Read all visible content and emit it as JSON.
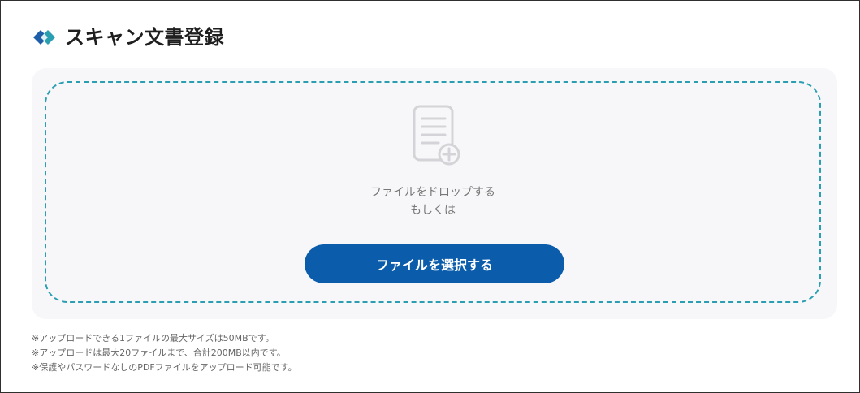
{
  "header": {
    "title": "スキャン文書登録",
    "icon": "document-logo-icon"
  },
  "upload": {
    "drop_icon": "document-add-icon",
    "drop_text_line1": "ファイルをドロップする",
    "drop_text_line2": "もしくは",
    "select_button_label": "ファイルを選択する"
  },
  "notes": [
    "※アップロードできる1ファイルの最大サイズは50MBです。",
    "※アップロードは最大20ファイルまで、合計200MB以内です。",
    "※保護やパスワードなしのPDFファイルをアップロード可能です。"
  ],
  "colors": {
    "brand_primary": "#0b5cab",
    "brand_secondary": "#2a9fb1",
    "panel_bg": "#f7f7f9"
  }
}
